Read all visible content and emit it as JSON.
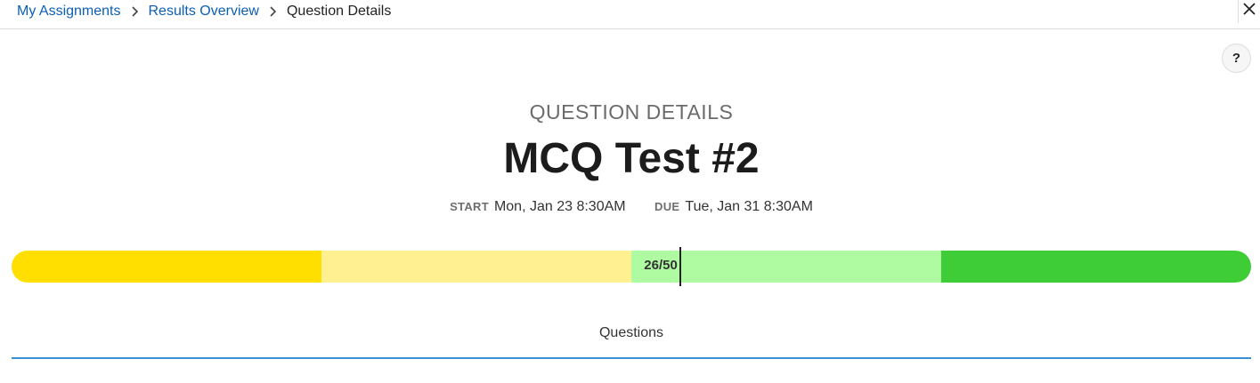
{
  "breadcrumb": {
    "items": [
      {
        "label": "My Assignments",
        "link": true
      },
      {
        "label": "Results Overview",
        "link": true
      },
      {
        "label": "Question Details",
        "link": false
      }
    ]
  },
  "icons": {
    "close": "close-icon",
    "help": "help-icon",
    "separator": "chevron-right-icon"
  },
  "help_label": "?",
  "header": {
    "kicker": "QUESTION DETAILS",
    "title": "MCQ Test #2"
  },
  "dates": {
    "start_label": "START",
    "start_value": "Mon, Jan 23 8:30AM",
    "due_label": "DUE",
    "due_value": "Tue, Jan 31 8:30AM"
  },
  "score": {
    "label": "26/50",
    "score": 26,
    "max": 50,
    "bands": [
      {
        "name": "band-low",
        "from": 0,
        "to": 0.25,
        "color": "#ffdf00"
      },
      {
        "name": "band-below-mid",
        "from": 0.25,
        "to": 0.5,
        "color": "#fff192"
      },
      {
        "name": "band-above-mid",
        "from": 0.5,
        "to": 0.75,
        "color": "#aefba2"
      },
      {
        "name": "band-high",
        "from": 0.75,
        "to": 1.0,
        "color": "#3ecd36"
      }
    ]
  },
  "section": {
    "tab_label": "Questions",
    "accent_color": "#3a8fd4"
  },
  "colors": {
    "link": "#0b5fb5",
    "text": "#222222",
    "muted": "#6b6b6b"
  }
}
